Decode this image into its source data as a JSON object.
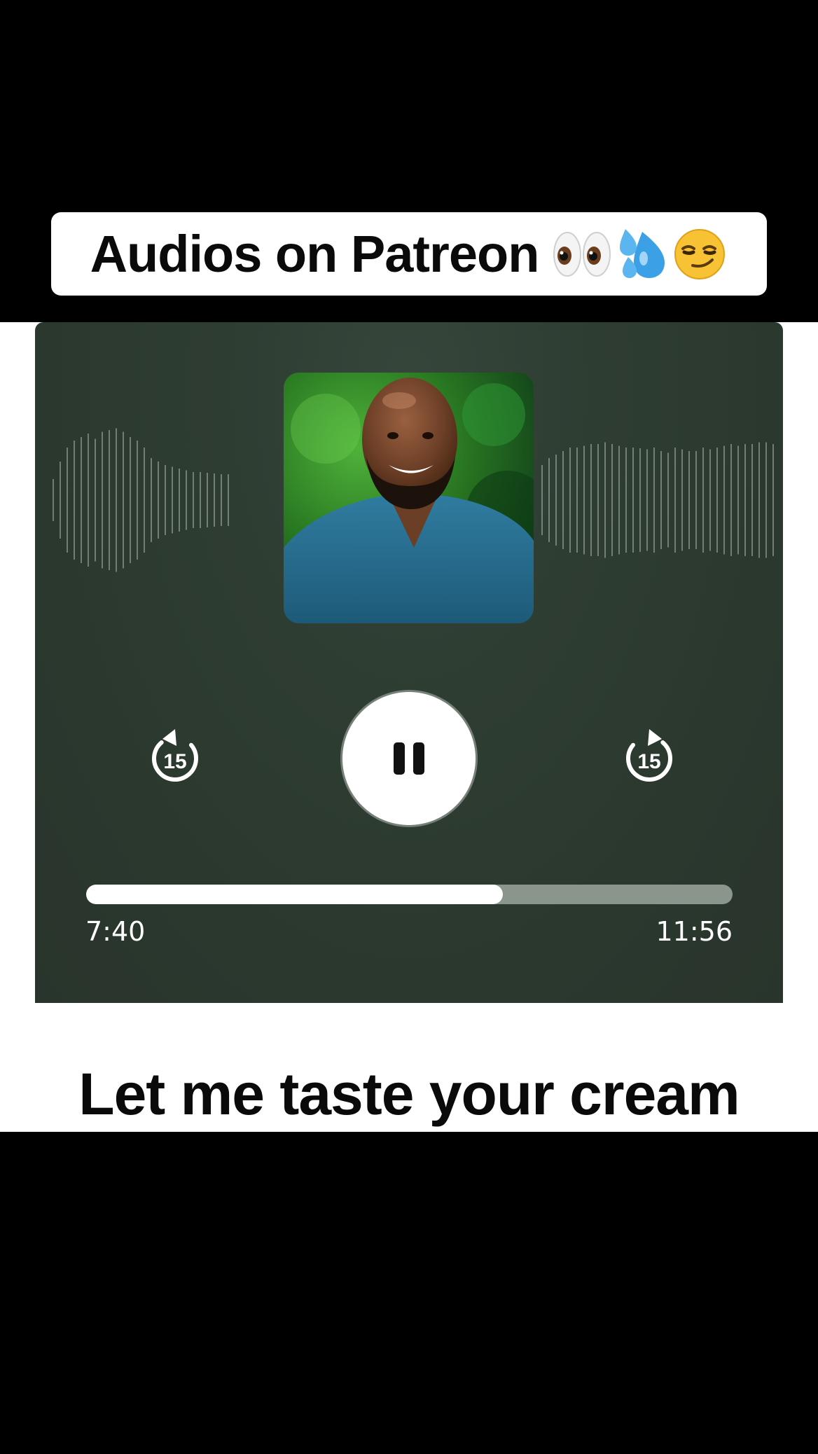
{
  "caption": {
    "text": "Audios on Patreon",
    "emojis": [
      "eyes-emoji",
      "sweat-droplets-emoji",
      "smirking-face-emoji"
    ]
  },
  "player": {
    "skip_back_seconds": "15",
    "skip_forward_seconds": "15",
    "state": "playing",
    "elapsed": "7:40",
    "total": "11:56",
    "progress": 0.645,
    "colors": {
      "background": "#2b382e",
      "track": "#8a968c",
      "fill": "#ffffff"
    }
  },
  "post": {
    "title": "Let me taste your cream"
  }
}
